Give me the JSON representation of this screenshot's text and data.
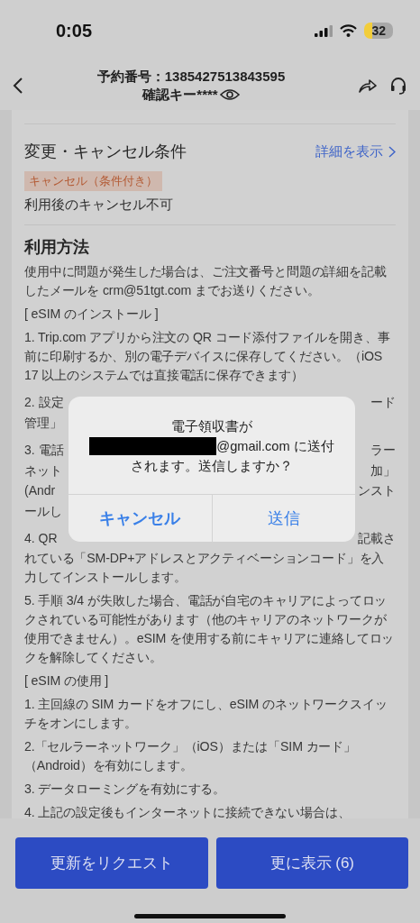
{
  "status_bar": {
    "time": "0:05",
    "battery": "32"
  },
  "header": {
    "booking_number": "予約番号：1385427513843595",
    "confirmation_key": "確認キー****"
  },
  "cancellation": {
    "title": "変更・キャンセル条件",
    "details_link": "詳細を表示",
    "badge": "キャンセル（条件付き）",
    "note": "利用後のキャンセル不可"
  },
  "usage": {
    "title": "利用方法",
    "blocks": [
      {
        "kind": "text",
        "text": "使用中に問題が発生した場合は、ご注文番号と問題の詳細を記載したメールを crm@51tgt.com までお送りください。"
      },
      {
        "kind": "text",
        "text": "[ eSIM のインストール ]"
      },
      {
        "kind": "text",
        "text": "1. Trip.com アプリから注文の QR コード添付ファイルを開き、事前に印刷するか、別の電子デバイスに保存してください。（iOS 17 以上のシステムでは直接電話に保存できます）"
      },
      {
        "kind": "covered",
        "lines": [
          {
            "left": "2. 設定",
            "right": "ード"
          },
          {
            "left": "管理」"
          }
        ]
      },
      {
        "kind": "covered",
        "lines": [
          {
            "left": "3. 電話",
            "right": "ラー"
          },
          {
            "left": "ネット",
            "right": "加」"
          },
          {
            "left": "(Andr",
            "right": "ンスト"
          },
          {
            "left": "ールし"
          }
        ]
      },
      {
        "kind": "covered",
        "lines": [
          {
            "left": "4. QR",
            "right": "記載さ"
          }
        ],
        "continuation": "れている「SM-DP+アドレスとアクティベーションコード」を入力してインストールします。"
      },
      {
        "kind": "text",
        "text": "5. 手順 3/4 が失敗した場合、電話が自宅のキャリアによってロックされている可能性があります（他のキャリアのネットワークが使用できません）。eSIM を使用する前にキャリアに連絡してロックを解除してください。"
      },
      {
        "kind": "text",
        "text": "[ eSIM の使用 ]"
      },
      {
        "kind": "text",
        "text": "1. 主回線の SIM カードをオフにし、eSIM のネットワークスイッチをオンにします。"
      },
      {
        "kind": "text",
        "text": "2.「セルラーネットワーク」（iOS）または「SIM カード」（Android）を有効にします。"
      },
      {
        "kind": "text",
        "text": "3. データローミングを有効にする。"
      },
      {
        "kind": "text",
        "text": "4. 上記の設定後もインターネットに接続できない場合は、"
      }
    ]
  },
  "alert": {
    "line_1": "電子領収書が",
    "email_suffix": "@gmail.com に送付",
    "line_3": "されます。送信しますか？",
    "buttons": [
      {
        "label": "キャンセル",
        "preferred": true
      },
      {
        "label": "送信",
        "preferred": false
      }
    ]
  },
  "bottom_buttons": [
    "更新をリクエスト",
    "更に表示 (6)"
  ]
}
